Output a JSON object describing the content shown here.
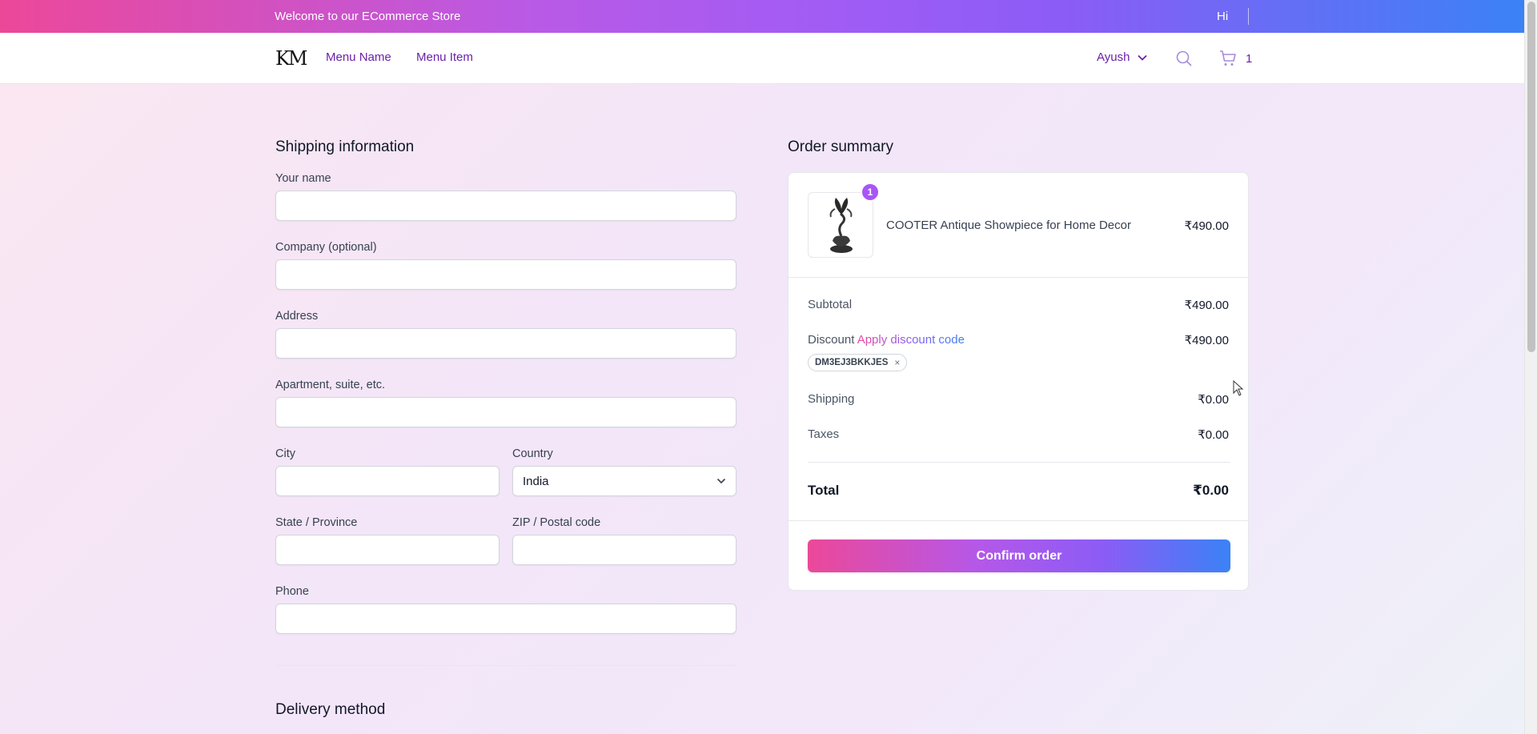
{
  "topbar": {
    "welcome": "Welcome to our ECommerce Store",
    "greeting": "Hi"
  },
  "nav": {
    "logo": "KM",
    "links": [
      "Menu Name",
      "Menu Item"
    ],
    "user": "Ayush",
    "cart_count": "1",
    "icons": {
      "search": "search-icon",
      "cart": "cart-icon",
      "user_dropdown": "chevron-down-icon"
    }
  },
  "shipping": {
    "title": "Shipping information",
    "fields": {
      "name": {
        "label": "Your name",
        "value": ""
      },
      "company": {
        "label": "Company (optional)",
        "value": ""
      },
      "address": {
        "label": "Address",
        "value": ""
      },
      "apartment": {
        "label": "Apartment, suite, etc.",
        "value": ""
      },
      "city": {
        "label": "City",
        "value": ""
      },
      "country": {
        "label": "Country",
        "value": "India"
      },
      "state": {
        "label": "State / Province",
        "value": ""
      },
      "zip": {
        "label": "ZIP / Postal code",
        "value": ""
      },
      "phone": {
        "label": "Phone",
        "value": ""
      }
    }
  },
  "delivery": {
    "title": "Delivery method"
  },
  "summary": {
    "title": "Order summary",
    "item": {
      "name": "COOTER Antique Showpiece for Home Decor",
      "price": "₹490.00",
      "quantity": "1"
    },
    "subtotal": {
      "label": "Subtotal",
      "value": "₹490.00"
    },
    "discount": {
      "label": "Discount",
      "link": "Apply discount code",
      "value": "₹490.00",
      "code": "DM3EJ3BKKJES",
      "remove": "×"
    },
    "shipping": {
      "label": "Shipping",
      "value": "₹0.00"
    },
    "taxes": {
      "label": "Taxes",
      "value": "₹0.00"
    },
    "total": {
      "label": "Total",
      "value": "₹0.00"
    },
    "confirm": "Confirm order"
  },
  "colors": {
    "accent": "#6b21a8",
    "gradient_start": "#ec4899",
    "gradient_mid": "#8b5cf6",
    "gradient_end": "#3b82f6"
  }
}
